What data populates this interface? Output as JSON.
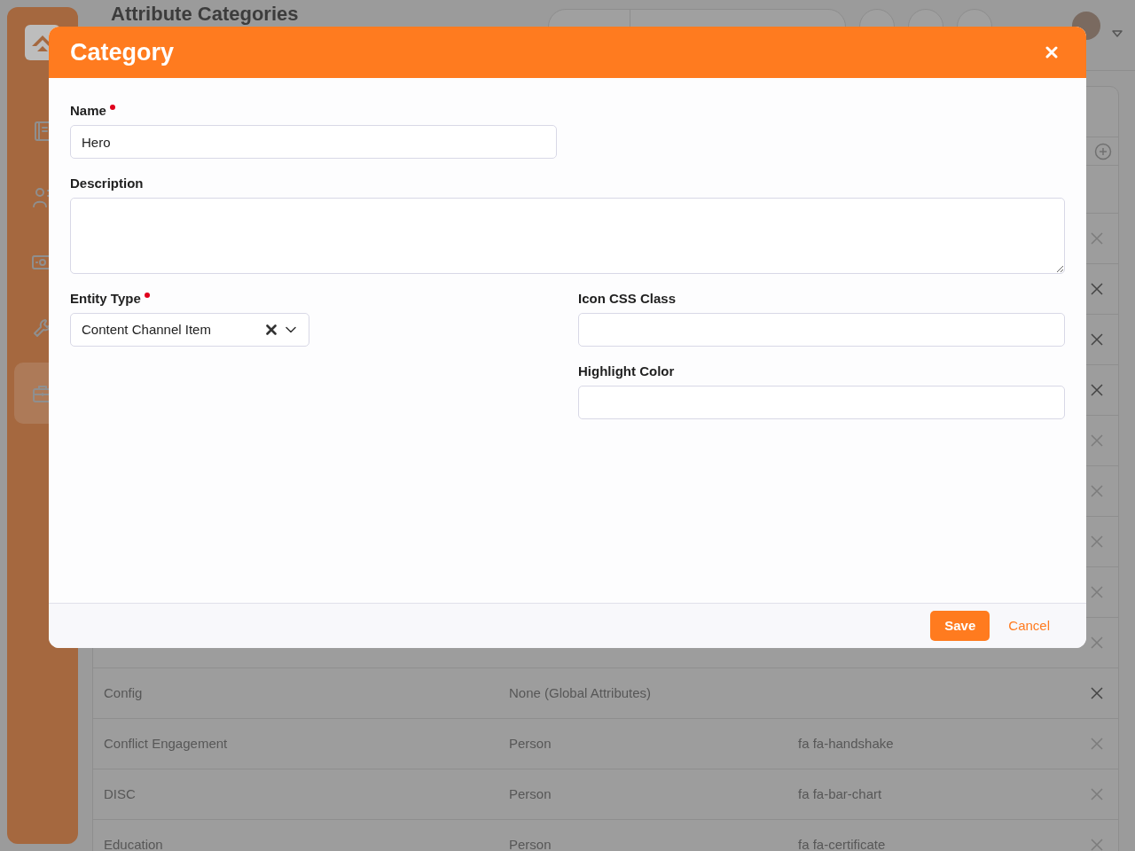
{
  "sidebar": {
    "items": [
      {
        "selected": false
      },
      {
        "selected": false
      },
      {
        "selected": false
      },
      {
        "selected": false
      },
      {
        "selected": true
      }
    ]
  },
  "header": {
    "title": "Attribute Categories"
  },
  "grid": {
    "rows": [
      {
        "delete_disabled": true
      },
      {
        "delete_disabled": false
      },
      {
        "delete_disabled": false
      },
      {
        "delete_disabled": false
      },
      {
        "delete_disabled": true
      },
      {
        "delete_disabled": true
      },
      {
        "delete_disabled": true
      },
      {
        "delete_disabled": true
      },
      {
        "delete_disabled": true
      },
      {
        "column_1": "Config",
        "column_2": "None (Global Attributes)",
        "delete_disabled": false
      },
      {
        "column_1": "Conflict Engagement",
        "column_2": "Person",
        "column_3": "fa fa-handshake",
        "delete_disabled": true
      },
      {
        "column_1": "DISC",
        "column_2": "Person",
        "column_3": "fa fa-bar-chart",
        "delete_disabled": true
      },
      {
        "column_1": "Education",
        "column_2": "Person",
        "column_3": "fa fa-certificate",
        "delete_disabled": true
      }
    ]
  },
  "modal": {
    "title": "Category",
    "name": {
      "label": "Name",
      "required": true,
      "value": "Hero"
    },
    "description": {
      "label": "Description",
      "required": false
    },
    "entity_type": {
      "label": "Entity Type",
      "required": true,
      "value": "Content Channel Item"
    },
    "icon_css_class": {
      "label": "Icon CSS Class",
      "required": false
    },
    "highlight_color": {
      "label": "Highlight Color",
      "required": false
    },
    "buttons": [
      {
        "label": "Save",
        "kind": "primary"
      },
      {
        "label": "Cancel",
        "kind": "link"
      }
    ]
  }
}
